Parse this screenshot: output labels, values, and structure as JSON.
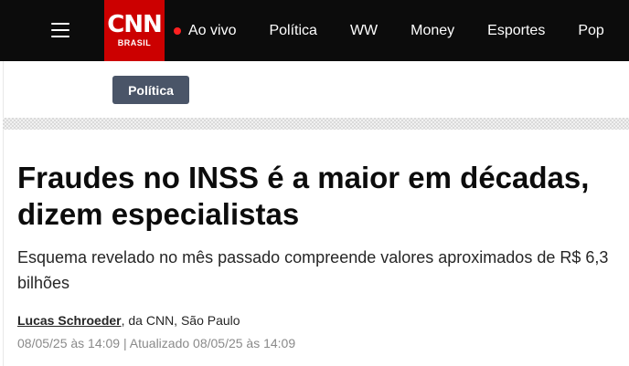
{
  "header": {
    "logo_text": "CNN",
    "logo_subtext": "BRASIL",
    "nav_items": [
      {
        "label": "Ao vivo",
        "live": true
      },
      {
        "label": "Política"
      },
      {
        "label": "WW"
      },
      {
        "label": "Money"
      },
      {
        "label": "Esportes"
      },
      {
        "label": "Pop"
      }
    ]
  },
  "section_tag": "Política",
  "article": {
    "headline": "Fraudes no INSS é a maior em décadas, dizem especialistas",
    "subheadline": "Esquema revelado no mês passado compreende valores aproximados de R$ 6,3 bilhões",
    "author": "Lucas Schroeder",
    "byline_suffix": ", da CNN, São Paulo",
    "published": "08/05/25 às 14:09",
    "separator": " | ",
    "updated": "Atualizado 08/05/25 às 14:09"
  },
  "colors": {
    "topbar": "#0c0c0c",
    "brand_red": "#cc0000",
    "live_dot": "#ff2020",
    "tag_bg": "#4a5568"
  }
}
